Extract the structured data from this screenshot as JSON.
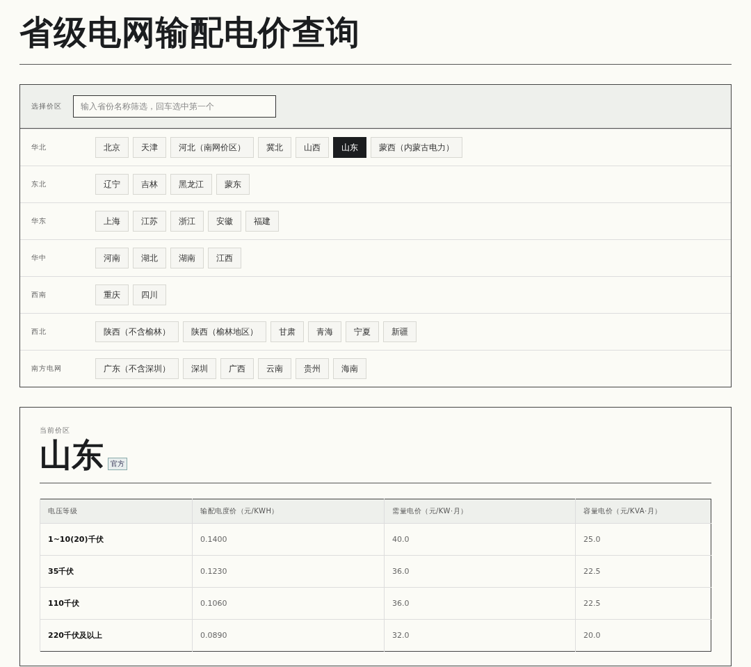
{
  "title": "省级电网输配电价查询",
  "filter": {
    "label": "选择价区",
    "placeholder": "输入省份名称筛选，回车选中第一个"
  },
  "regions": [
    {
      "name": "华北",
      "provinces": [
        {
          "label": "北京",
          "selected": false
        },
        {
          "label": "天津",
          "selected": false
        },
        {
          "label": "河北（南网价区）",
          "selected": false
        },
        {
          "label": "冀北",
          "selected": false
        },
        {
          "label": "山西",
          "selected": false
        },
        {
          "label": "山东",
          "selected": true
        },
        {
          "label": "蒙西（内蒙古电力）",
          "selected": false
        }
      ]
    },
    {
      "name": "东北",
      "provinces": [
        {
          "label": "辽宁",
          "selected": false
        },
        {
          "label": "吉林",
          "selected": false
        },
        {
          "label": "黑龙江",
          "selected": false
        },
        {
          "label": "蒙东",
          "selected": false
        }
      ]
    },
    {
      "name": "华东",
      "provinces": [
        {
          "label": "上海",
          "selected": false
        },
        {
          "label": "江苏",
          "selected": false
        },
        {
          "label": "浙江",
          "selected": false
        },
        {
          "label": "安徽",
          "selected": false
        },
        {
          "label": "福建",
          "selected": false
        }
      ]
    },
    {
      "name": "华中",
      "provinces": [
        {
          "label": "河南",
          "selected": false
        },
        {
          "label": "湖北",
          "selected": false
        },
        {
          "label": "湖南",
          "selected": false
        },
        {
          "label": "江西",
          "selected": false
        }
      ]
    },
    {
      "name": "西南",
      "provinces": [
        {
          "label": "重庆",
          "selected": false
        },
        {
          "label": "四川",
          "selected": false
        }
      ]
    },
    {
      "name": "西北",
      "provinces": [
        {
          "label": "陕西（不含榆林）",
          "selected": false
        },
        {
          "label": "陕西（榆林地区）",
          "selected": false
        },
        {
          "label": "甘肃",
          "selected": false
        },
        {
          "label": "青海",
          "selected": false
        },
        {
          "label": "宁夏",
          "selected": false
        },
        {
          "label": "新疆",
          "selected": false
        }
      ]
    },
    {
      "name": "南方电网",
      "provinces": [
        {
          "label": "广东（不含深圳）",
          "selected": false
        },
        {
          "label": "深圳",
          "selected": false
        },
        {
          "label": "广西",
          "selected": false
        },
        {
          "label": "云南",
          "selected": false
        },
        {
          "label": "贵州",
          "selected": false
        },
        {
          "label": "海南",
          "selected": false
        }
      ]
    }
  ],
  "current": {
    "caption": "当前价区",
    "name": "山东",
    "badge": "官方"
  },
  "table": {
    "columns": [
      "电压等级",
      "输配电度价（元/KWH）",
      "需量电价（元/KW·月）",
      "容量电价（元/KVA·月）"
    ],
    "rows": [
      [
        "1~10(20)千伏",
        "0.1400",
        "40.0",
        "25.0"
      ],
      [
        "35千伏",
        "0.1230",
        "36.0",
        "22.5"
      ],
      [
        "110千伏",
        "0.1060",
        "36.0",
        "22.5"
      ],
      [
        "220千伏及以上",
        "0.0890",
        "32.0",
        "20.0"
      ]
    ]
  }
}
